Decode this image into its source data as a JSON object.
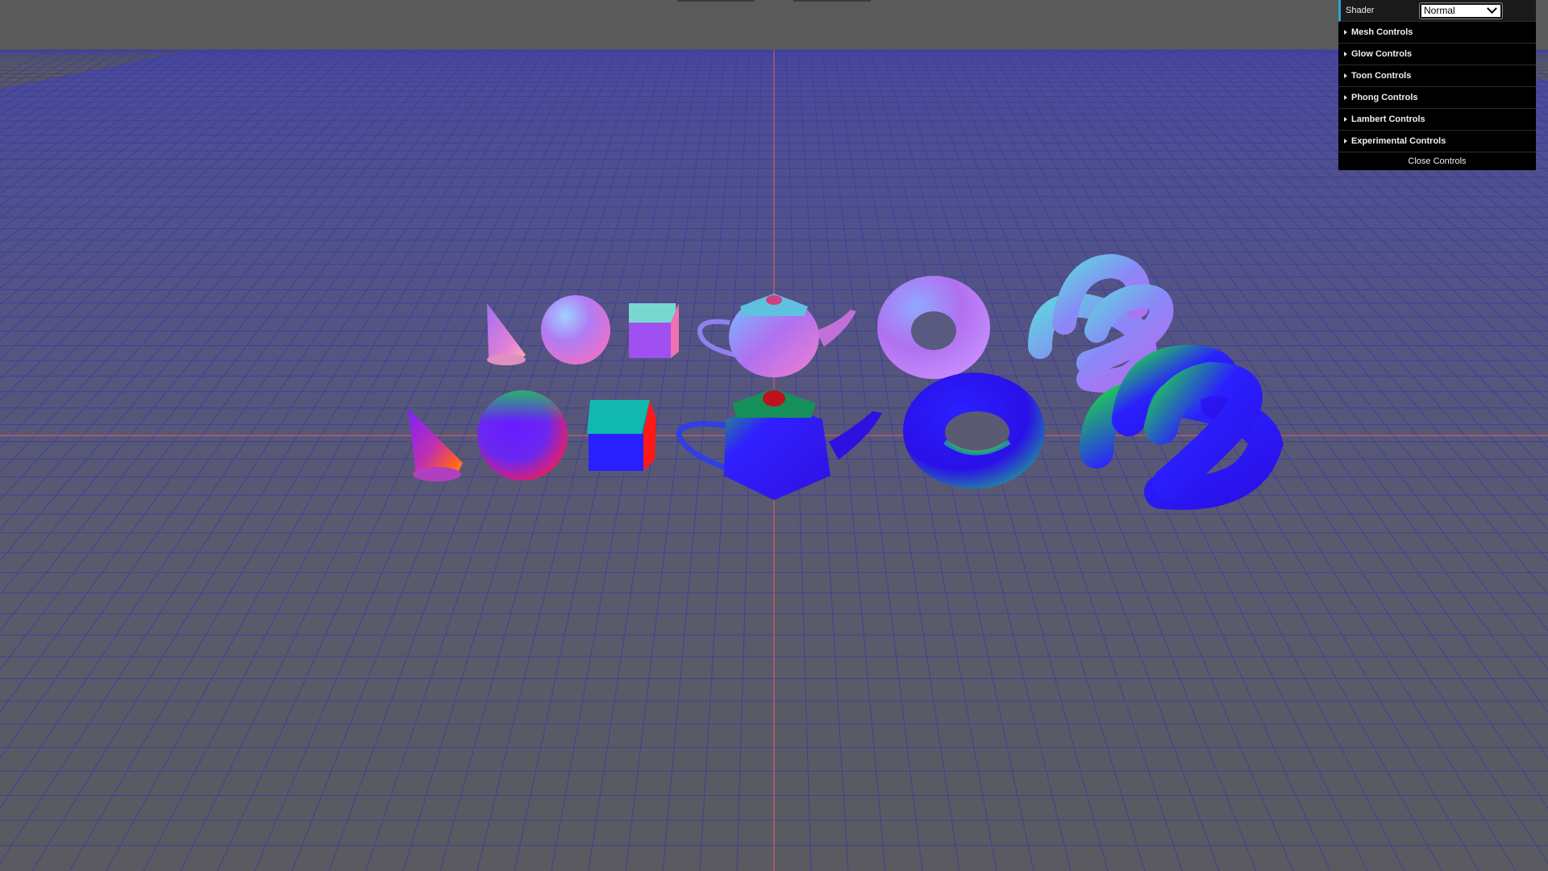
{
  "scene": {
    "background_color": "#5a5a5a",
    "grid_color": "#3c3c9c",
    "axis_color": "#e06060",
    "plane_tint": "#4a4a9a",
    "objects_back_row": [
      "cone",
      "sphere",
      "cube",
      "teapot",
      "torus",
      "torus-knot"
    ],
    "objects_front_row": [
      "cone",
      "sphere",
      "cube",
      "teapot",
      "torus",
      "torus-knot"
    ]
  },
  "gui": {
    "shader_label": "Shader",
    "shader_value": "Normal",
    "folders": [
      {
        "label": "Mesh Controls"
      },
      {
        "label": "Glow Controls"
      },
      {
        "label": "Toon Controls"
      },
      {
        "label": "Phong Controls"
      },
      {
        "label": "Lambert Controls"
      },
      {
        "label": "Experimental Controls"
      }
    ],
    "close_label": "Close Controls",
    "accent_color": "#2fa1d6"
  }
}
